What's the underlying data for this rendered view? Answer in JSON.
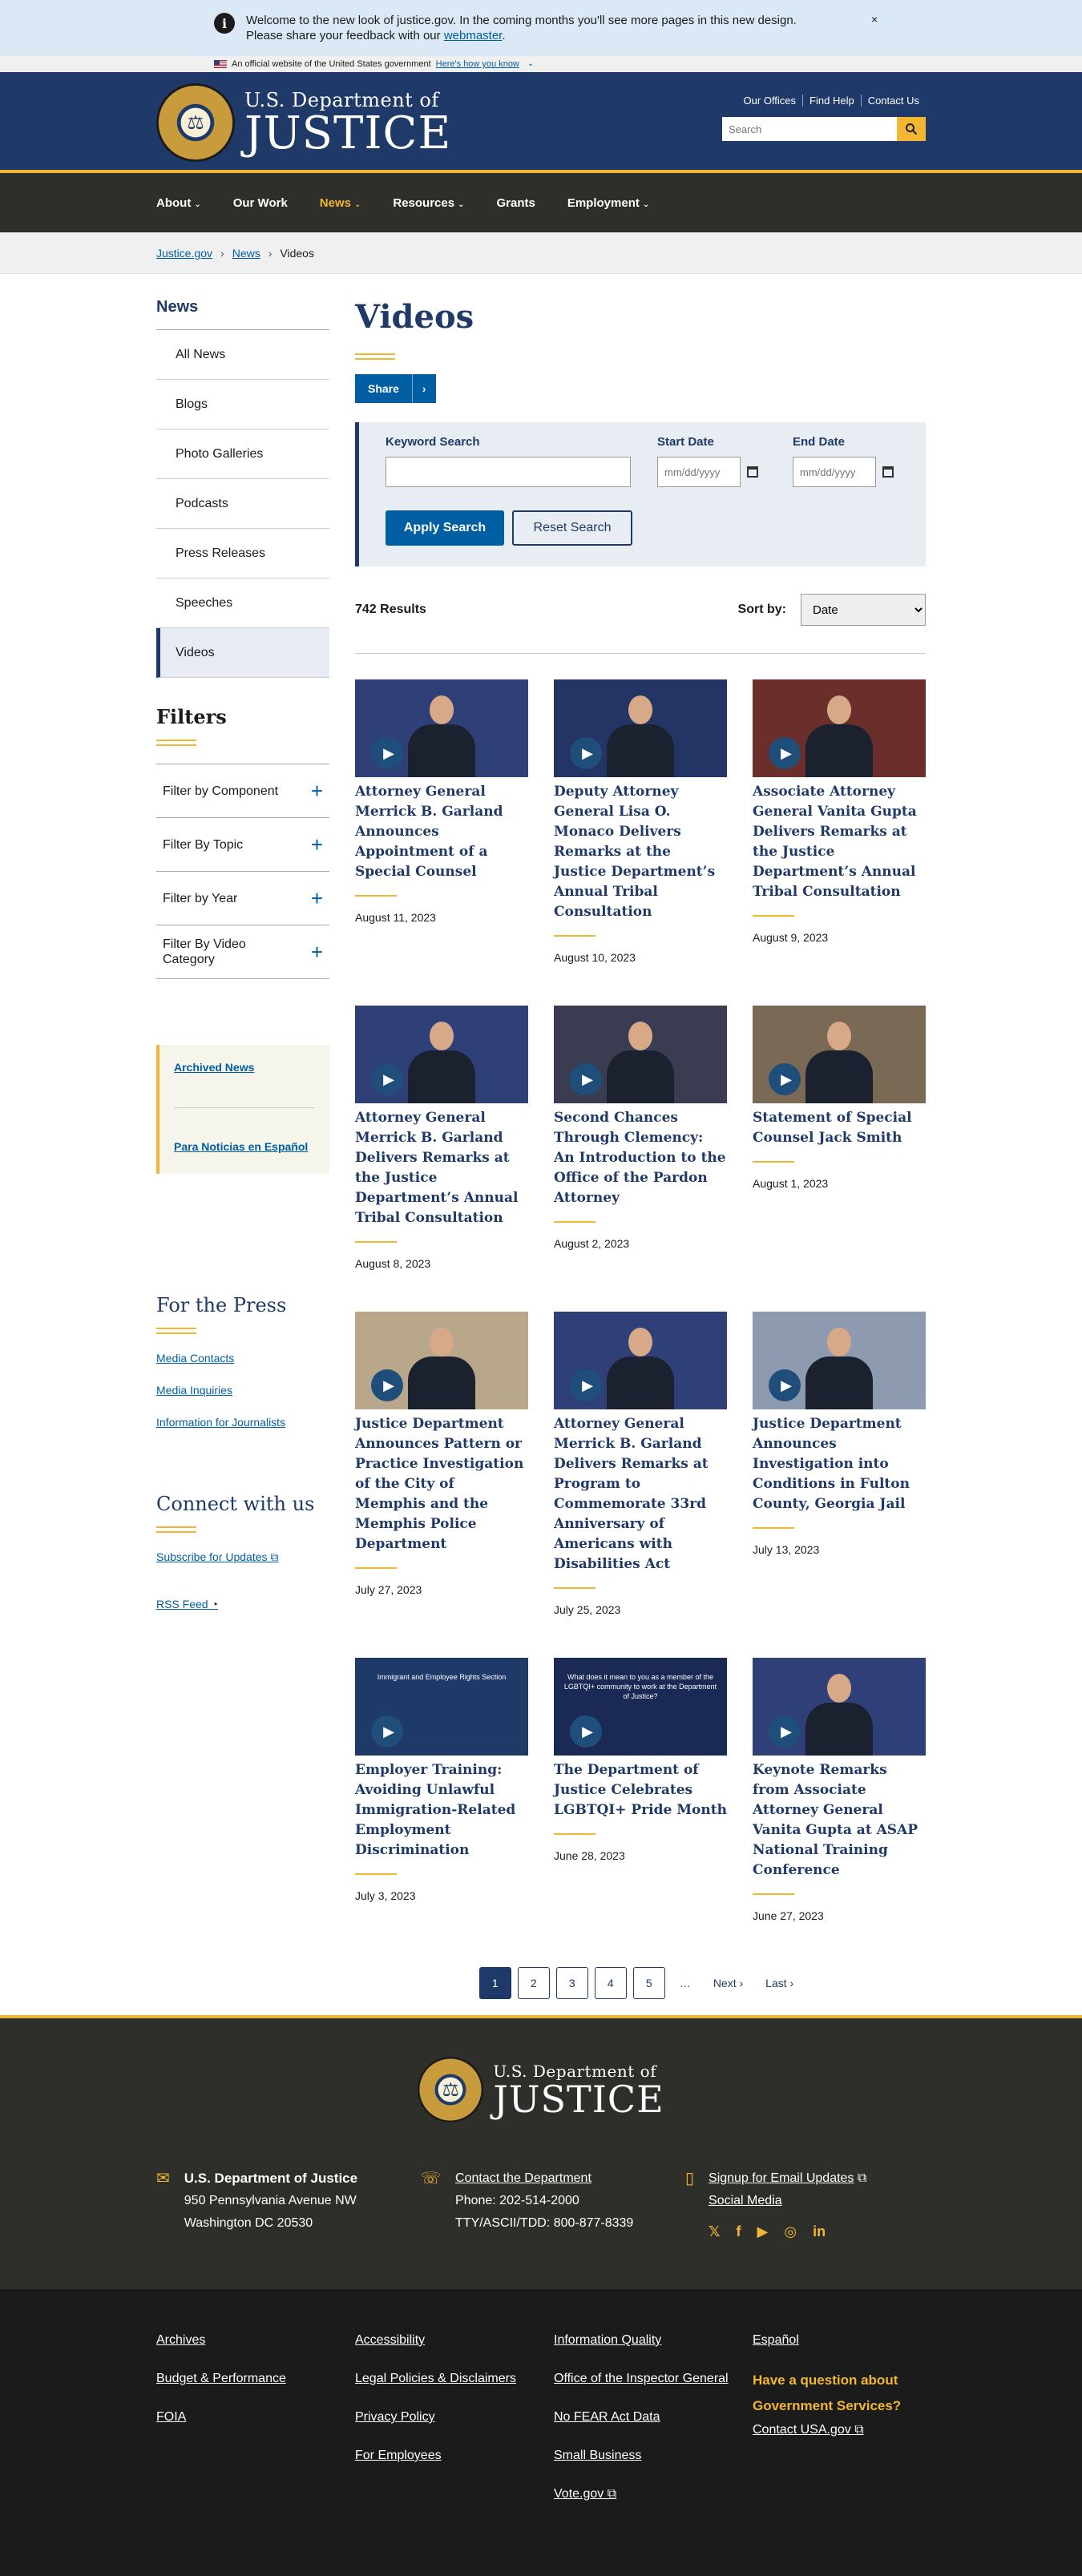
{
  "notice": {
    "text_pre": "Welcome to the new look of justice.gov. In the coming months you'll see more pages in this new design. Please share your feedback with our ",
    "link": "webmaster",
    "text_post": ".",
    "close": "×"
  },
  "gov_banner": {
    "text": "An official website of the United States government",
    "link": "Here's how you know"
  },
  "header": {
    "logo_small": "U.S. Department of",
    "logo_big": "JUSTICE",
    "util": [
      "Our Offices",
      "Find Help",
      "Contact Us"
    ],
    "search_placeholder": "Search"
  },
  "nav": [
    {
      "label": "About",
      "caret": true
    },
    {
      "label": "Our Work",
      "caret": false
    },
    {
      "label": "News",
      "caret": true
    },
    {
      "label": "Resources",
      "caret": true
    },
    {
      "label": "Grants",
      "caret": false
    },
    {
      "label": "Employment",
      "caret": true
    }
  ],
  "breadcrumb": [
    "Justice.gov",
    "News",
    "Videos"
  ],
  "sidebar": {
    "title": "News",
    "items": [
      "All News",
      "Blogs",
      "Photo Galleries",
      "Podcasts",
      "Press Releases",
      "Speeches",
      "Videos"
    ],
    "filters_title": "Filters",
    "filters": [
      "Filter by Component",
      "Filter By Topic",
      "Filter by Year",
      "Filter By Video Category"
    ],
    "box_links": [
      "Archived News",
      "Para Noticias en Español"
    ],
    "press_title": "For the Press",
    "press_links": [
      "Media Contacts",
      "Media Inquiries",
      "Information for Journalists"
    ],
    "connect_title": "Connect with us",
    "connect_links": [
      "Subscribe for Updates",
      "RSS Feed"
    ]
  },
  "page": {
    "title": "Videos",
    "share": "Share"
  },
  "search": {
    "keyword_label": "Keyword Search",
    "start_label": "Start Date",
    "end_label": "End Date",
    "date_placeholder": "mm/dd/yyyy",
    "apply": "Apply Search",
    "reset": "Reset Search"
  },
  "results": {
    "count": "742 Results",
    "sort_label": "Sort by:",
    "sort_value": "Date"
  },
  "videos": [
    {
      "title": "Attorney General Merrick B. Garland Announces Appointment of a Special Counsel",
      "date": "August 11, 2023",
      "bg": "#2f3f78"
    },
    {
      "title": "Deputy Attorney General Lisa O. Monaco Delivers Remarks at the Justice Department’s Annual Tribal Consultation",
      "date": "August 10, 2023",
      "bg": "#243565"
    },
    {
      "title": "Associate Attorney General Vanita Gupta Delivers Remarks at the Justice Department’s Annual Tribal Consultation",
      "date": "August 9, 2023",
      "bg": "#6a2f2a"
    },
    {
      "title": "Attorney General Merrick B. Garland Delivers Remarks at the Justice Department’s Annual Tribal Consultation",
      "date": "August 8, 2023",
      "bg": "#2f3f78"
    },
    {
      "title": "Second Chances Through Clemency: An Introduction to the Office of the Pardon Attorney",
      "date": "August 2, 2023",
      "bg": "#3a3d52"
    },
    {
      "title": "Statement of Special Counsel Jack Smith",
      "date": "August 1, 2023",
      "bg": "#7a6a55"
    },
    {
      "title": "Justice Department Announces Pattern or Practice Investigation of the City of Memphis and the Memphis Police Department",
      "date": "July 27, 2023",
      "bg": "#b9a78c"
    },
    {
      "title": "Attorney General Merrick B. Garland Delivers Remarks at Program to Commemorate 33rd Anniversary of Americans with Disabilities Act",
      "date": "July 25, 2023",
      "bg": "#2f3f78"
    },
    {
      "title": "Justice Department Announces Investigation into Conditions in Fulton County, Georgia Jail",
      "date": "July 13, 2023",
      "bg": "#8d9ab0"
    },
    {
      "title": "Employer Training: Avoiding Unlawful Immigration-Related Employment Discrimination",
      "date": "July 3, 2023",
      "bg": "#1f3a68",
      "caption": "Immigrant and Employee Rights Section"
    },
    {
      "title": "The Department of Justice Celebrates LGBTQI+ Pride Month",
      "date": "June 28, 2023",
      "bg": "#1b2a55",
      "caption": "What does it mean to you as a member of the LGBTQI+ community to work at the Department of Justice?"
    },
    {
      "title": "Keynote Remarks from Associate Attorney General Vanita Gupta at ASAP National Training Conference",
      "date": "June 27, 2023",
      "bg": "#2f3f78"
    }
  ],
  "pagination": {
    "pages": [
      "1",
      "2",
      "3",
      "4",
      "5"
    ],
    "ellipsis": "…",
    "next": "Next ›",
    "last": "Last ›"
  },
  "footer": {
    "logo_small": "U.S. Department of",
    "logo_big": "JUSTICE",
    "address_title": "U.S. Department of Justice",
    "address_1": "950 Pennsylvania Avenue NW",
    "address_2": "Washington DC 20530",
    "contact_link": "Contact the Department",
    "phone": "Phone: 202-514-2000",
    "tty": "TTY/ASCII/TDD: 800-877-8339",
    "email_link": "Signup for Email Updates",
    "social_link": "Social Media",
    "social": [
      "𝕏",
      "f",
      "▶",
      "◎",
      "in"
    ],
    "col1": [
      "Archives",
      "Budget & Performance",
      "FOIA"
    ],
    "col2": [
      "Accessibility",
      "Legal Policies & Disclaimers",
      "Privacy Policy",
      "For Employees"
    ],
    "col3": [
      "Information Quality",
      "Office of the Inspector General",
      "No FEAR Act Data",
      "Small Business",
      "Vote.gov"
    ],
    "col4_link": "Español",
    "question": "Have a question about Government Services?",
    "usa_link": "Contact USA.gov"
  },
  "colors": {
    "navy": "#1f3a68",
    "gold": "#f2b632",
    "link": "#005ea2",
    "dark": "#2e2f2a"
  }
}
